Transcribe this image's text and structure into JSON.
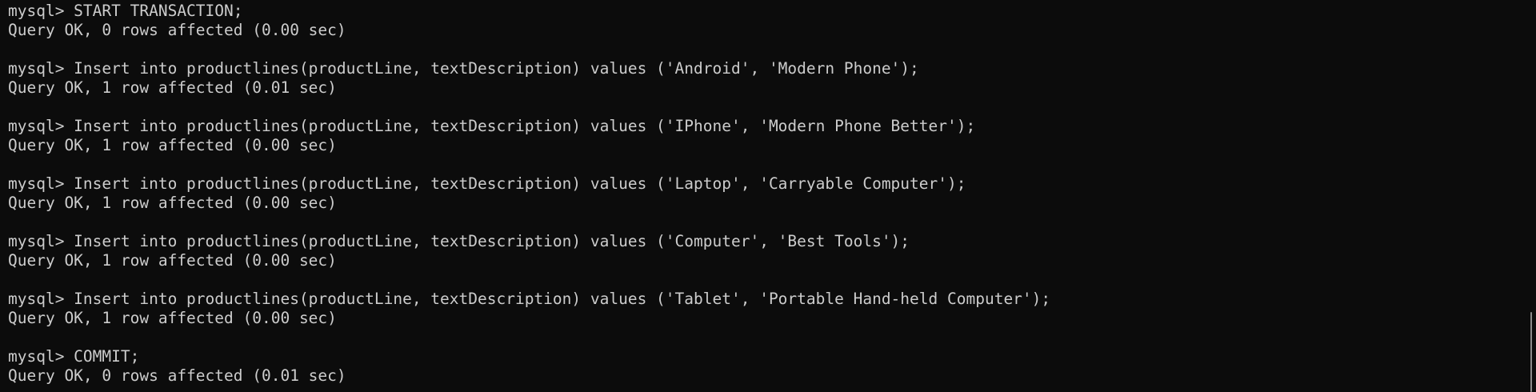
{
  "terminal": {
    "lines": [
      "mysql> START TRANSACTION;",
      "Query OK, 0 rows affected (0.00 sec)",
      "",
      "mysql> Insert into productlines(productLine, textDescription) values ('Android', 'Modern Phone');",
      "Query OK, 1 row affected (0.01 sec)",
      "",
      "mysql> Insert into productlines(productLine, textDescription) values ('IPhone', 'Modern Phone Better');",
      "Query OK, 1 row affected (0.00 sec)",
      "",
      "mysql> Insert into productlines(productLine, textDescription) values ('Laptop', 'Carryable Computer');",
      "Query OK, 1 row affected (0.00 sec)",
      "",
      "mysql> Insert into productlines(productLine, textDescription) values ('Computer', 'Best Tools');",
      "Query OK, 1 row affected (0.00 sec)",
      "",
      "mysql> Insert into productlines(productLine, textDescription) values ('Tablet', 'Portable Hand-held Computer');",
      "Query OK, 1 row affected (0.00 sec)",
      "",
      "mysql> COMMIT;",
      "Query OK, 0 rows affected (0.01 sec)"
    ]
  },
  "colors": {
    "background": "#0c0c0c",
    "text": "#cccccc",
    "scrollbar": "#8a8a8a"
  }
}
